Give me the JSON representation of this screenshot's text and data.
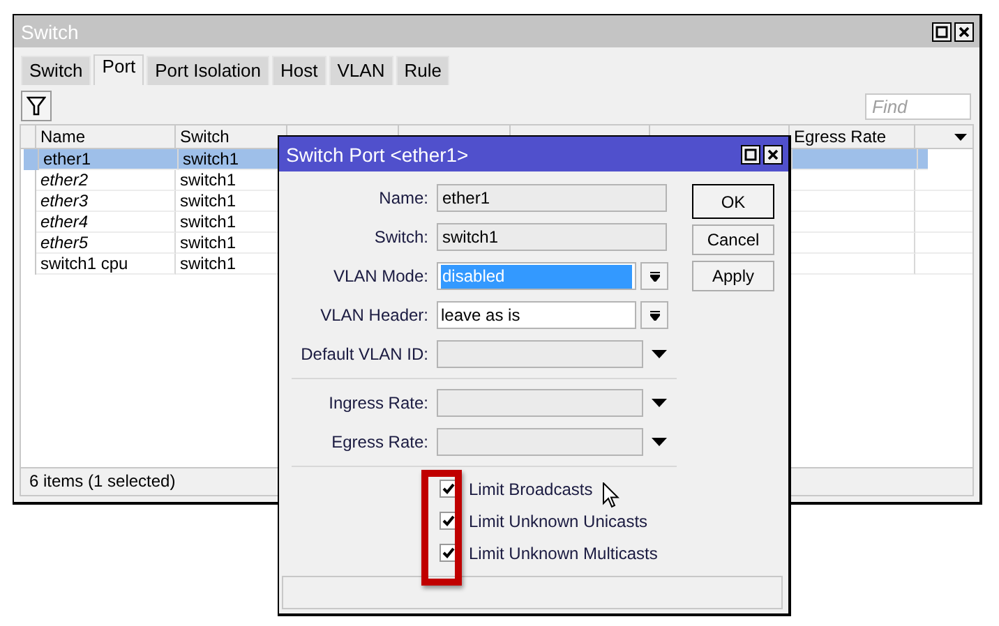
{
  "window": {
    "title": "Switch"
  },
  "tabs": [
    {
      "label": "Switch",
      "selected": false
    },
    {
      "label": "Port",
      "selected": true
    },
    {
      "label": "Port Isolation",
      "selected": false
    },
    {
      "label": "Host",
      "selected": false
    },
    {
      "label": "VLAN",
      "selected": false
    },
    {
      "label": "Rule",
      "selected": false
    }
  ],
  "search": {
    "placeholder": "Find"
  },
  "table": {
    "columns": [
      "Name",
      "Switch",
      "",
      "",
      "",
      "",
      "Egress Rate"
    ],
    "rows": [
      {
        "name": "ether1",
        "switch": "switch1",
        "selected": true,
        "running": true
      },
      {
        "name": "ether2",
        "switch": "switch1",
        "selected": false,
        "running": false
      },
      {
        "name": "ether3",
        "switch": "switch1",
        "selected": false,
        "running": false
      },
      {
        "name": "ether4",
        "switch": "switch1",
        "selected": false,
        "running": false
      },
      {
        "name": "ether5",
        "switch": "switch1",
        "selected": false,
        "running": false
      },
      {
        "name": "switch1 cpu",
        "switch": "switch1",
        "selected": false,
        "running": true
      }
    ]
  },
  "status_bar": "6 items (1 selected)",
  "dialog": {
    "title": "Switch Port <ether1>",
    "fields": [
      {
        "label": "Name:",
        "kind": "readonly",
        "value": "ether1"
      },
      {
        "label": "Switch:",
        "kind": "readonly",
        "value": "switch1"
      },
      {
        "label": "VLAN Mode:",
        "kind": "select",
        "value": "disabled",
        "highlighted": true
      },
      {
        "label": "VLAN Header:",
        "kind": "select",
        "value": "leave as is",
        "highlighted": false
      },
      {
        "label": "Default VLAN ID:",
        "kind": "combo"
      },
      {
        "kind": "separator"
      },
      {
        "label": "Ingress Rate:",
        "kind": "combo"
      },
      {
        "label": "Egress Rate:",
        "kind": "combo"
      },
      {
        "kind": "separator"
      }
    ],
    "checkboxes": [
      {
        "label": "Limit Broadcasts",
        "checked": true
      },
      {
        "label": "Limit Unknown Unicasts",
        "checked": true
      },
      {
        "label": "Limit Unknown Multicasts",
        "checked": true
      }
    ],
    "buttons": [
      "OK",
      "Cancel",
      "Apply"
    ]
  }
}
